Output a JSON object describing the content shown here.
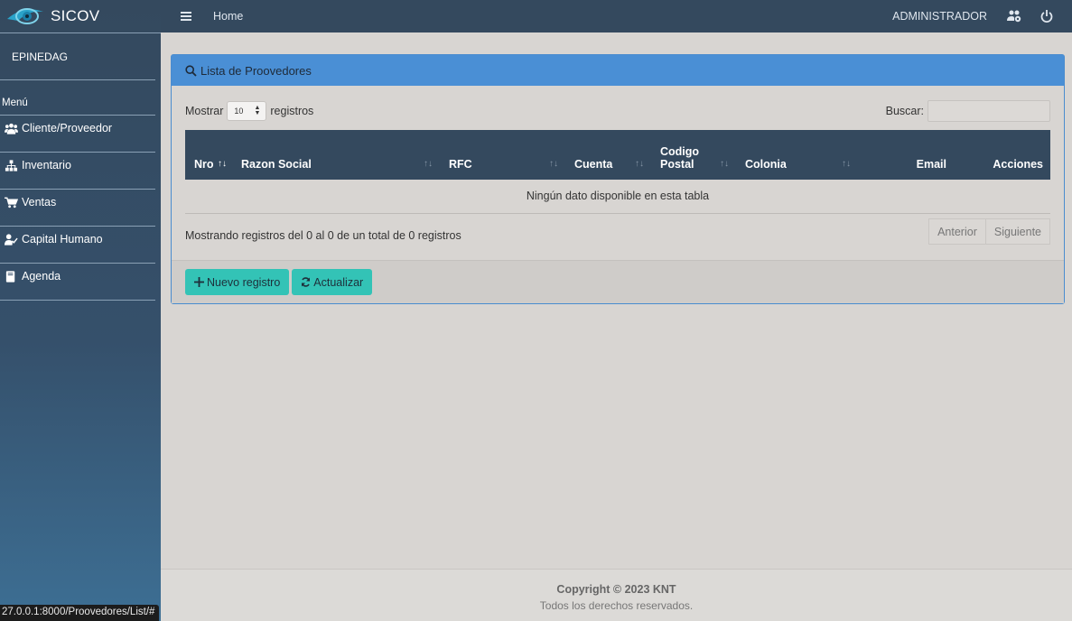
{
  "app": {
    "name": "SICOV",
    "user": "EPINEDAG",
    "menu_title": "Menú"
  },
  "sidebar": {
    "items": [
      {
        "label": "Cliente/Proveedor",
        "icon": "users-icon"
      },
      {
        "label": "Inventario",
        "icon": "sitemap-icon"
      },
      {
        "label": "Ventas",
        "icon": "cart-icon"
      },
      {
        "label": "Capital Humano",
        "icon": "user-check-icon"
      },
      {
        "label": "Agenda",
        "icon": "book-icon"
      }
    ]
  },
  "topbar": {
    "home": "Home",
    "user": "ADMINISTRADOR"
  },
  "panel": {
    "title": "Lista de Proovedores",
    "show_label": "Mostrar",
    "page_size": "10",
    "records_label": "registros",
    "search_label": "Buscar:",
    "columns": [
      "Nro",
      "Razon Social",
      "RFC",
      "Cuenta",
      "Codigo Postal",
      "Colonia",
      "Email",
      "Acciones"
    ],
    "empty_message": "Ningún dato disponible en esta tabla",
    "info": "Mostrando registros del 0 al 0 de un total de 0 registros",
    "prev": "Anterior",
    "next": "Siguiente",
    "new_button": "Nuevo registro",
    "refresh_button": "Actualizar"
  },
  "footer": {
    "copyright": "Copyright © 2023 KNT",
    "rights": "Todos los derechos reservados."
  },
  "status_url": "27.0.0.1:8000/Proovedores/List/#",
  "colors": {
    "sidebar": "#34495e",
    "panel_header": "#4a8fd5",
    "button": "#33c3b6"
  }
}
